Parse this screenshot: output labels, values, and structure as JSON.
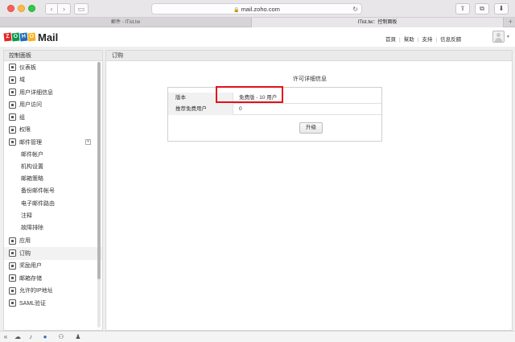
{
  "browser": {
    "url": "mail.zoho.com",
    "tabs": [
      {
        "label": "郵件 - ITist.tw"
      },
      {
        "label": "ITist.tw：控制面板"
      }
    ],
    "tab_add": "+"
  },
  "header": {
    "logo_letters": [
      "Z",
      "O",
      "H",
      "O"
    ],
    "logo_text": "Mail",
    "links": [
      "首頁",
      "幫助",
      "支持",
      "信息反饋"
    ]
  },
  "sidebar": {
    "title": "控制面板",
    "items": [
      {
        "label": "仪表板",
        "icon": "dashboard-icon"
      },
      {
        "label": "域",
        "icon": "domain-icon"
      },
      {
        "label": "用户详细信息",
        "icon": "user-details-icon"
      },
      {
        "label": "用户访问",
        "icon": "user-access-icon"
      },
      {
        "label": "组",
        "icon": "group-icon"
      },
      {
        "label": "权限",
        "icon": "permission-icon"
      },
      {
        "label": "邮件管理",
        "icon": "mail-admin-icon",
        "expandable": true
      }
    ],
    "subitems": [
      "邮件帐户",
      "机构设置",
      "邮箱策略",
      "备份邮件帐号",
      "电子邮件路由",
      "注释",
      "故障排除"
    ],
    "items_after": [
      {
        "label": "应用",
        "icon": "apps-icon"
      },
      {
        "label": "订购",
        "icon": "dollar-icon",
        "active": true
      },
      {
        "label": "奖励用户",
        "icon": "reward-icon"
      },
      {
        "label": "邮箱存储",
        "icon": "storage-icon"
      },
      {
        "label": "允许的IP地址",
        "icon": "globe-icon"
      },
      {
        "label": "SAML验证",
        "icon": "saml-icon"
      }
    ]
  },
  "content": {
    "title": "订购",
    "license_title": "许可详细信息",
    "rows": [
      {
        "label": "版本",
        "value": "免费版 - 10 用户"
      },
      {
        "label": "推荐免费用户",
        "value": "0"
      }
    ],
    "upgrade_label": "升级"
  },
  "colors": {
    "highlight": "#e4101a",
    "logo_red": "#e42527",
    "logo_green": "#089949",
    "logo_blue": "#226db4",
    "logo_yellow": "#f9b21d"
  }
}
